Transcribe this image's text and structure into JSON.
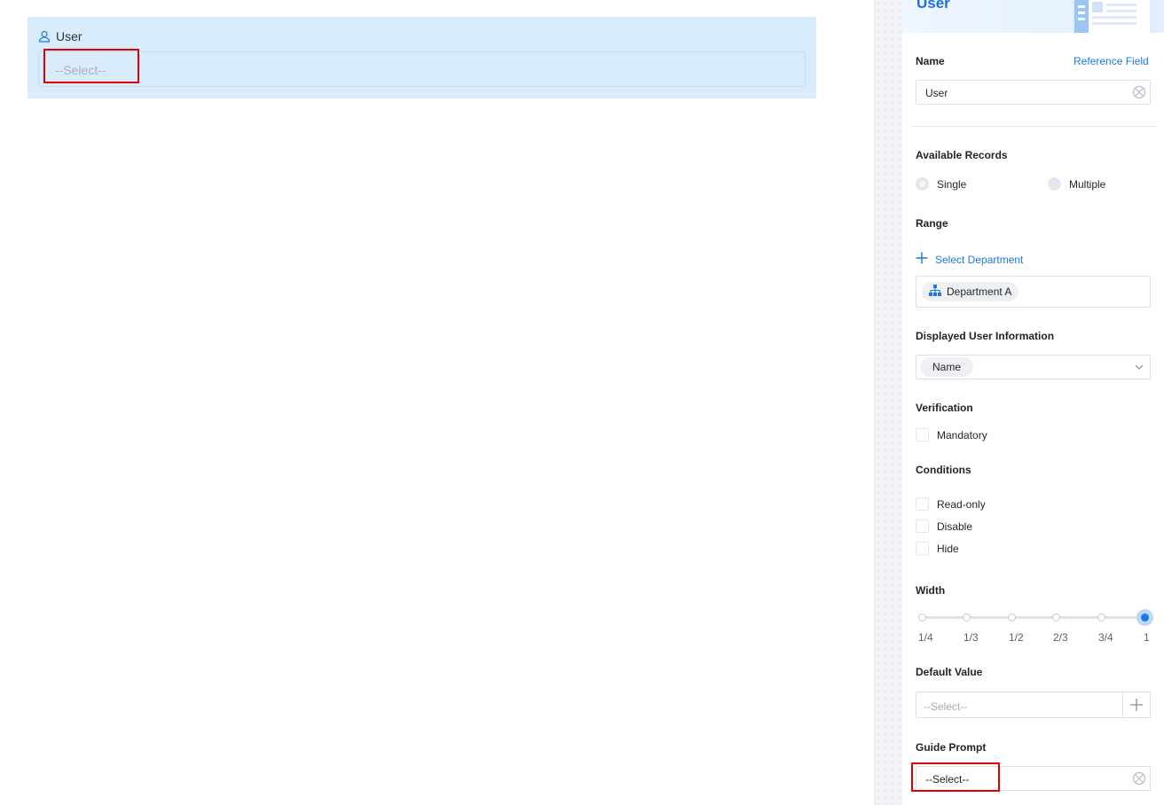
{
  "canvas": {
    "field_label": "User",
    "field_placeholder": "--Select--"
  },
  "panel": {
    "title": "User",
    "name_label": "Name",
    "reference_field_link": "Reference Field",
    "name_value": "User",
    "available_records_label": "Available Records",
    "records_options": [
      {
        "label": "Single",
        "selected": true
      },
      {
        "label": "Multiple",
        "selected": false
      }
    ],
    "range_label": "Range",
    "select_department_link": "Select Department",
    "department_tag": "Department A",
    "displayed_info_label": "Displayed User Information",
    "displayed_info_tag": "Name",
    "verification_label": "Verification",
    "mandatory_label": "Mandatory",
    "conditions_label": "Conditions",
    "conditions": [
      "Read-only",
      "Disable",
      "Hide"
    ],
    "width_label": "Width",
    "width_ticks": [
      "1/4",
      "1/3",
      "1/2",
      "2/3",
      "3/4",
      "1"
    ],
    "width_value": "1",
    "default_value_label": "Default Value",
    "default_value_placeholder": "--Select--",
    "guide_prompt_label": "Guide Prompt",
    "guide_prompt_value": "--Select--"
  },
  "colors": {
    "accent": "#1a7adf",
    "highlight": "#e00000",
    "field_block_bg": "#d8ecfc"
  }
}
